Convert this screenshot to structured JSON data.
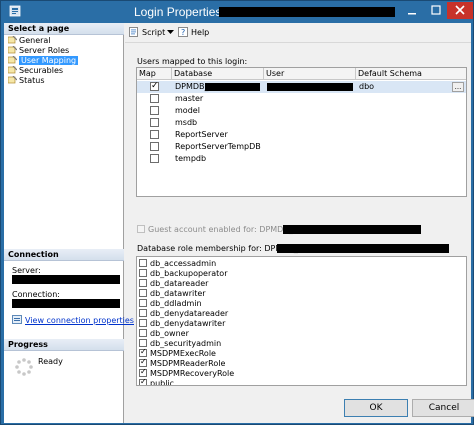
{
  "window": {
    "title": "Login Properties - "
  },
  "left_panel": {
    "select_page_header": "Select a page",
    "pages": [
      {
        "label": "General",
        "selected": false
      },
      {
        "label": "Server Roles",
        "selected": false
      },
      {
        "label": "User Mapping",
        "selected": true
      },
      {
        "label": "Securables",
        "selected": false
      },
      {
        "label": "Status",
        "selected": false
      }
    ],
    "connection_header": "Connection",
    "server_label": "Server:",
    "connection_label": "Connection:",
    "view_connection_link": "View connection properties",
    "progress_header": "Progress",
    "progress_status": "Ready"
  },
  "toolbar": {
    "script_label": "Script",
    "help_label": "Help"
  },
  "mapping": {
    "caption": "Users mapped to this login:",
    "columns": [
      "Map",
      "Database",
      "User",
      "Default Schema"
    ],
    "rows": [
      {
        "map": true,
        "database": "DPMDB_",
        "user": "",
        "schema": "dbo",
        "selected": true
      },
      {
        "map": false,
        "database": "master",
        "user": "",
        "schema": ""
      },
      {
        "map": false,
        "database": "model",
        "user": "",
        "schema": ""
      },
      {
        "map": false,
        "database": "msdb",
        "user": "",
        "schema": ""
      },
      {
        "map": false,
        "database": "ReportServer",
        "user": "",
        "schema": ""
      },
      {
        "map": false,
        "database": "ReportServerTempDB",
        "user": "",
        "schema": ""
      },
      {
        "map": false,
        "database": "tempdb",
        "user": "",
        "schema": ""
      }
    ],
    "ellipsis_label": "..."
  },
  "guest": {
    "label": "Guest account enabled for: DPMDB_",
    "checked": false
  },
  "roles": {
    "caption": "Database role membership for: DPMDB_",
    "items": [
      {
        "label": "db_accessadmin",
        "checked": false
      },
      {
        "label": "db_backupoperator",
        "checked": false
      },
      {
        "label": "db_datareader",
        "checked": false
      },
      {
        "label": "db_datawriter",
        "checked": false
      },
      {
        "label": "db_ddladmin",
        "checked": false
      },
      {
        "label": "db_denydatareader",
        "checked": false
      },
      {
        "label": "db_denydatawriter",
        "checked": false
      },
      {
        "label": "db_owner",
        "checked": false
      },
      {
        "label": "db_securityadmin",
        "checked": false
      },
      {
        "label": "MSDPMExecRole",
        "checked": true
      },
      {
        "label": "MSDPMReaderRole",
        "checked": true
      },
      {
        "label": "MSDPMRecoveryRole",
        "checked": true
      },
      {
        "label": "public",
        "checked": true
      }
    ]
  },
  "buttons": {
    "ok_label": "OK",
    "cancel_label": "Cancel"
  }
}
